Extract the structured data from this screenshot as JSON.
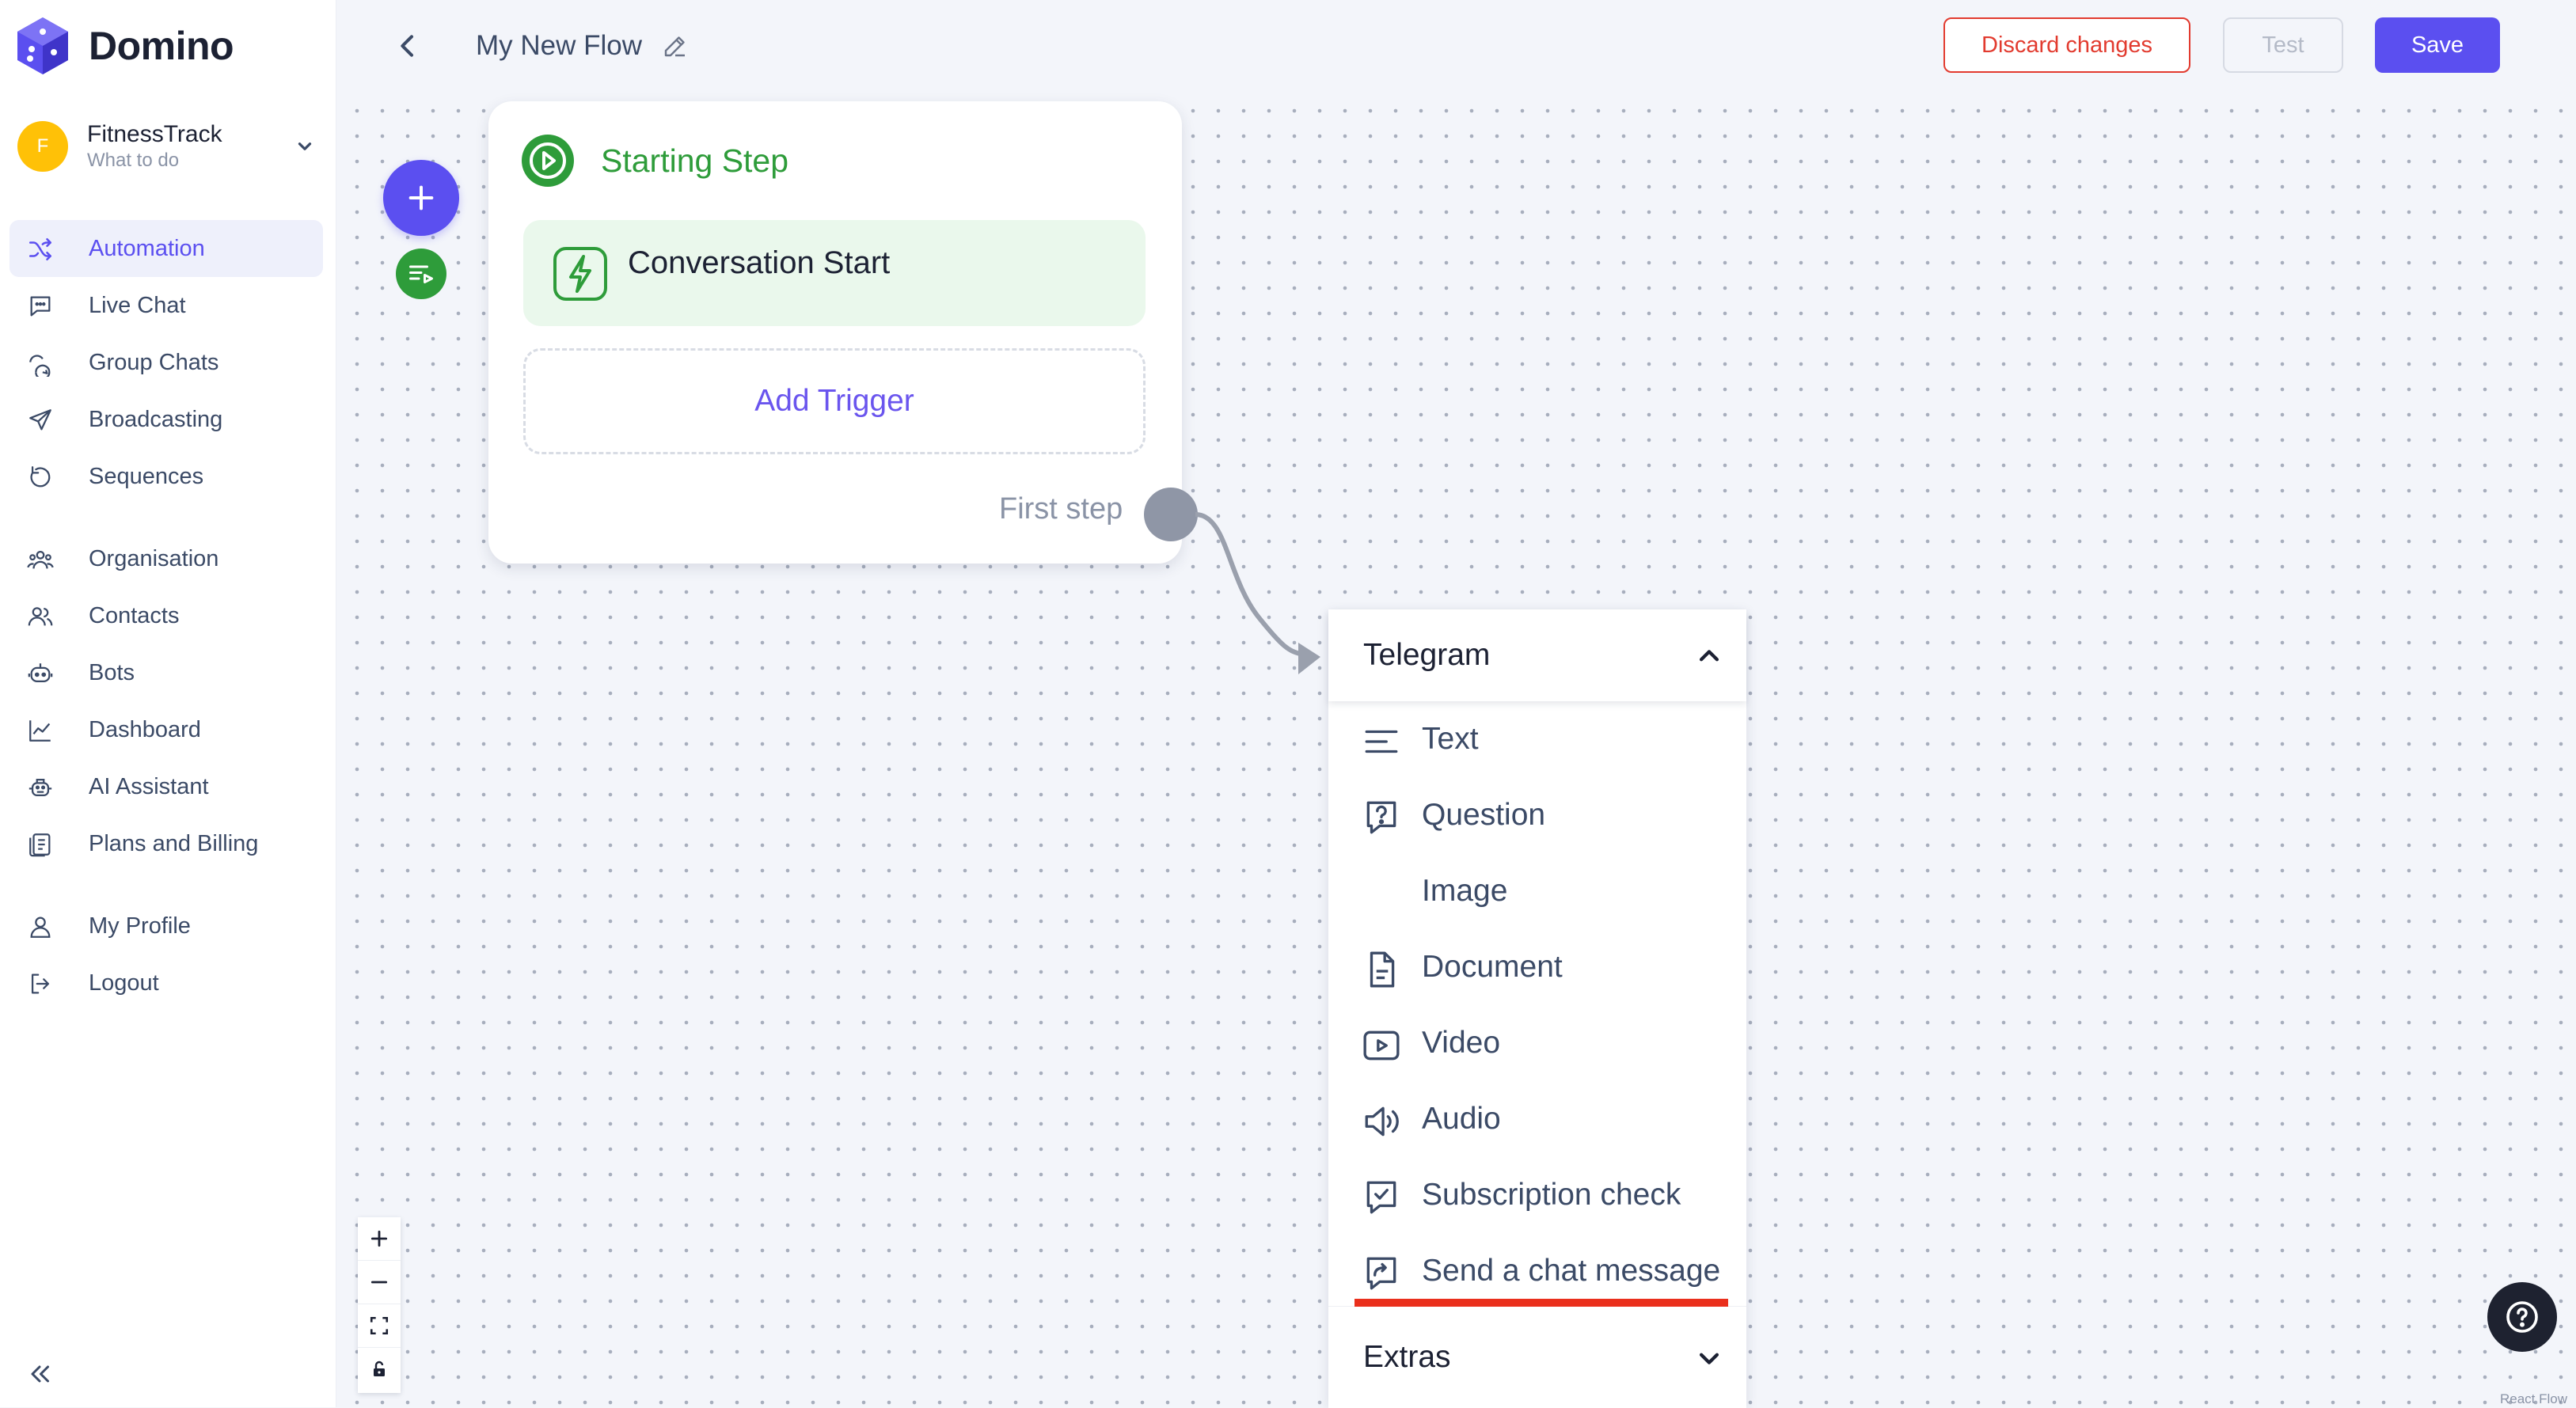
{
  "brand": {
    "name": "Domino"
  },
  "org": {
    "avatar_letter": "F",
    "name": "FitnessTrack",
    "subtitle": "What to do"
  },
  "sidebar": {
    "items": [
      {
        "label": "Automation",
        "icon": "shuffle-icon",
        "active": true
      },
      {
        "label": "Live Chat",
        "icon": "chat-bubble-icon"
      },
      {
        "label": "Group Chats",
        "icon": "group-chat-icon"
      },
      {
        "label": "Broadcasting",
        "icon": "paper-plane-icon"
      },
      {
        "label": "Sequences",
        "icon": "loop-icon"
      },
      {
        "label": "Organisation",
        "icon": "organisation-icon"
      },
      {
        "label": "Contacts",
        "icon": "contacts-icon"
      },
      {
        "label": "Bots",
        "icon": "bot-icon"
      },
      {
        "label": "Dashboard",
        "icon": "chart-line-icon"
      },
      {
        "label": "AI Assistant",
        "icon": "robot-icon"
      },
      {
        "label": "Plans and Billing",
        "icon": "billing-icon"
      },
      {
        "label": "My Profile",
        "icon": "user-icon"
      },
      {
        "label": "Logout",
        "icon": "logout-icon"
      }
    ]
  },
  "header": {
    "title": "My New Flow",
    "discard_label": "Discard changes",
    "test_label": "Test",
    "save_label": "Save"
  },
  "node": {
    "title": "Starting Step",
    "trigger_label": "Conversation Start",
    "add_trigger_label": "Add Trigger",
    "first_step_label": "First step"
  },
  "menu": {
    "section_title": "Telegram",
    "items": [
      {
        "label": "Text",
        "icon": "text-lines-icon"
      },
      {
        "label": "Question",
        "icon": "question-bubble-icon"
      },
      {
        "label": "Image",
        "icon": ""
      },
      {
        "label": "Document",
        "icon": "document-icon"
      },
      {
        "label": "Video",
        "icon": "video-icon"
      },
      {
        "label": "Audio",
        "icon": "speaker-icon"
      },
      {
        "label": "Subscription check",
        "icon": "check-bubble-icon"
      },
      {
        "label": "Send a chat message",
        "icon": "forward-bubble-icon"
      }
    ],
    "extras_title": "Extras"
  },
  "attribution": "React Flow",
  "colors": {
    "accent": "#5b4ff0",
    "green": "#2e9c3a",
    "danger": "#e23b2f",
    "highlight_underline": "#ea2f1c"
  }
}
